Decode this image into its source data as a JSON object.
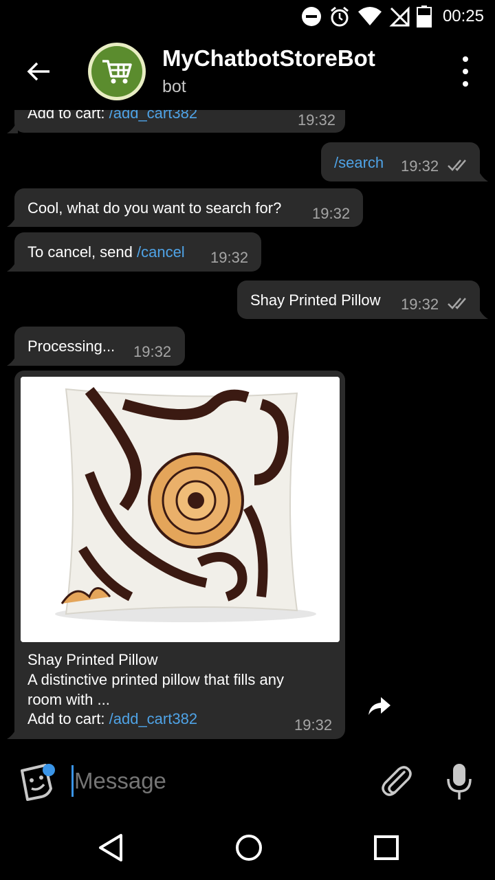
{
  "status_bar": {
    "time": "00:25",
    "icons": [
      "do-not-disturb-icon",
      "alarm-icon",
      "wifi-icon",
      "no-signal-icon",
      "battery-icon"
    ]
  },
  "header": {
    "title": "MyChatbotStoreBot",
    "subtitle": "bot",
    "back_icon": "arrow-left-icon",
    "menu_icon": "more-vert-icon",
    "avatar_icon": "shopping-cart-icon",
    "avatar_color": "#5b8c2e"
  },
  "messages": {
    "m0": {
      "text": "Add to cart: ",
      "link": "/add_cart382",
      "time": "19:32"
    },
    "m1": {
      "link": "/search",
      "time": "19:32"
    },
    "m2": {
      "text": "Cool, what do you want to search for?",
      "time": "19:32"
    },
    "m3": {
      "text": "To cancel, send ",
      "link": "/cancel",
      "time": "19:32"
    },
    "m4": {
      "text": "Shay Printed Pillow",
      "time": "19:32"
    },
    "m5": {
      "text": "Processing...",
      "time": "19:32"
    },
    "m6": {
      "name": "Shay Printed Pillow",
      "desc_line1": "A distinctive printed pillow that fills any",
      "desc_line2": "room with ...",
      "cart_label": "Add to cart: ",
      "cart_link": "/add_cart382",
      "time": "19:32"
    }
  },
  "input": {
    "placeholder": "Message"
  },
  "colors": {
    "bubble": "#2b2b2b",
    "link": "#4fa3e6",
    "time": "#a6a6a6"
  }
}
